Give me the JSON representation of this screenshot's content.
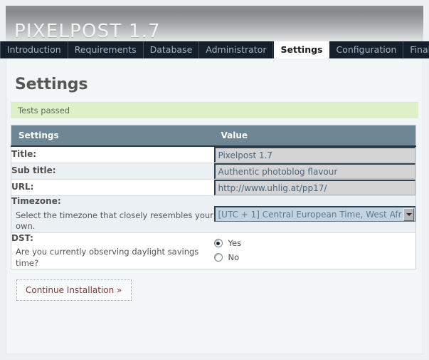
{
  "header": {
    "logo": "PIXELPOST 1.7"
  },
  "tabs": [
    {
      "label": "Introduction",
      "active": false
    },
    {
      "label": "Requirements",
      "active": false
    },
    {
      "label": "Database",
      "active": false
    },
    {
      "label": "Administrator",
      "active": false
    },
    {
      "label": "Settings",
      "active": true
    },
    {
      "label": "Configuration",
      "active": false
    },
    {
      "label": "Finalize",
      "active": false
    }
  ],
  "page": {
    "title": "Settings",
    "status_message": "Tests passed"
  },
  "table": {
    "headers": {
      "setting": "Settings",
      "value": "Value"
    },
    "rows": [
      {
        "label": "Title:",
        "description": "",
        "type": "text",
        "value": "Pixelpost 1.7",
        "name": "title"
      },
      {
        "label": "Sub title:",
        "description": "",
        "type": "text",
        "value": "Authentic photoblog flavour",
        "name": "sub-title"
      },
      {
        "label": "URL:",
        "description": "",
        "type": "text",
        "value": "http://www.uhlig.at/pp17/",
        "name": "url"
      },
      {
        "label": "Timezone:",
        "description": "Select the timezone that closely resembles your own.",
        "type": "select",
        "value": "[UTC + 1] Central European Time, West Afr",
        "name": "timezone"
      },
      {
        "label": "DST:",
        "description": "Are you currently observing daylight savings time?",
        "type": "radio",
        "options": [
          {
            "label": "Yes",
            "checked": true
          },
          {
            "label": "No",
            "checked": false
          }
        ],
        "name": "dst"
      }
    ]
  },
  "actions": {
    "continue_label": "Continue Installation »"
  },
  "colors": {
    "tab_bar": "#16202c",
    "table_header": "#6e8795",
    "status_success": "#ddf0c8",
    "button_text": "#7d3a3a"
  }
}
